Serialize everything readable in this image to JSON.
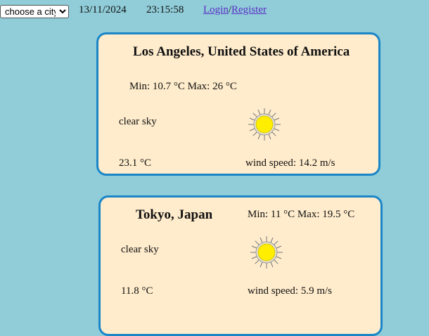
{
  "header": {
    "city_select_value": "choose a city",
    "date": "13/11/2024",
    "time": "23:15:58",
    "login_label": "Login",
    "separator": "/",
    "register_label": "Register"
  },
  "cards": [
    {
      "city": "Los Angeles, United States of America",
      "minmax": "Min: 10.7 °C Max: 26 °C",
      "description": "clear sky",
      "icon": "sun-icon",
      "temperature": "23.1 °C",
      "wind": "wind speed: 14.2 m/s"
    },
    {
      "city": "Tokyo, Japan",
      "minmax": "Min: 11 °C Max: 19.5 °C",
      "description": "clear sky",
      "icon": "sun-icon",
      "temperature": "11.8 °C",
      "wind": "wind speed: 5.9 m/s"
    }
  ],
  "colors": {
    "background": "#90cdd9",
    "card_background": "#ffeccc",
    "card_border": "#1a86c8",
    "link": "#5a2fc2",
    "sun": "#ffee00"
  }
}
